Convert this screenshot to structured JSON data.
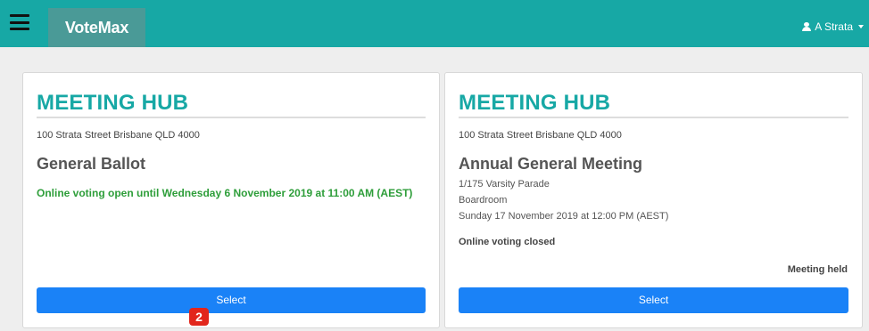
{
  "header": {
    "brand": "VoteMax",
    "user_name": "A Strata"
  },
  "cards": [
    {
      "title": "MEETING HUB",
      "address": "100 Strata Street Brisbane QLD 4000",
      "meeting_name": "General Ballot",
      "voting_status": "Online voting open until Wednesday 6 November 2019 at 11:00 AM (AEST)",
      "select_label": "Select"
    },
    {
      "title": "MEETING HUB",
      "address": "100 Strata Street Brisbane QLD 4000",
      "meeting_name": "Annual General Meeting",
      "location_line1": "1/175 Varsity Parade",
      "location_line2": "Boardroom",
      "datetime": "Sunday 17 November 2019 at 12:00 PM (AEST)",
      "voting_status": "Online voting closed",
      "meeting_status": "Meeting held",
      "select_label": "Select"
    }
  ],
  "badge": "2",
  "colors": {
    "header_bg": "#17a8a5",
    "brand_bg": "#4a9a97",
    "title": "#17a8a5",
    "button": "#1a82f7",
    "voting_open": "#2e9e3a",
    "badge": "#e2261c"
  },
  "icons": {
    "menu": "hamburger-icon",
    "user": "user-icon",
    "dropdown": "caret-down-icon"
  }
}
